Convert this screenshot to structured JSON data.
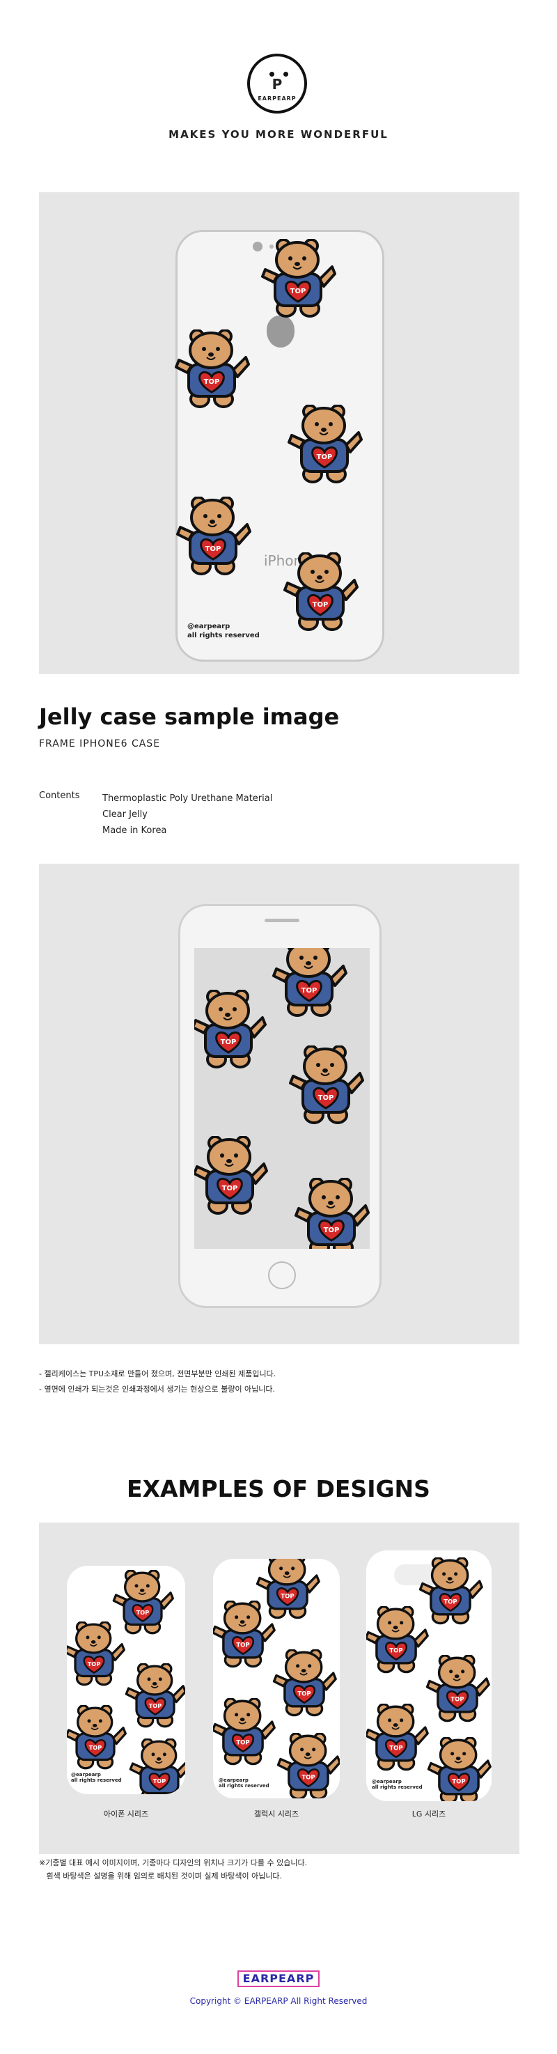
{
  "brand": {
    "logo_letter": "P",
    "logo_word": "EARPEARP",
    "tagline": "MAKES YOU MORE WONDERFUL"
  },
  "case_print": {
    "credit_line1": "@earpearp",
    "credit_line2": "all rights reserved",
    "bear_shirt_text": "TOP",
    "phone_text": "iPhone"
  },
  "product": {
    "title": "Jelly case sample image",
    "subtitle": "FRAME IPHONE6 CASE",
    "contents_label": "Contents",
    "contents": [
      "Thermoplastic Poly Urethane Material",
      "Clear Jelly",
      "Made in Korea"
    ]
  },
  "notes": [
    "- 젤리케이스는 TPU소재로 만들어 졌으며, 전면부분만 인쇄된 제품입니다.",
    "- 옆면에 인쇄가 되는것은 인쇄과정에서 생기는 현상으로 불량이 아닙니다."
  ],
  "examples": {
    "title": "EXAMPLES OF DESIGNS",
    "items": [
      {
        "label": "아이폰 시리즈"
      },
      {
        "label": "갤럭시 시리즈"
      },
      {
        "label": "LG 시리즈"
      }
    ]
  },
  "footnote": [
    "※기종별 대표 예시 이미지이며, 기종마다 디자인의 위치나 크기가 다를 수 있습니다.",
    "   흰색 바탕색은 설명을 위해 임의로 배치된 것이며 실제 바탕색이 아닙니다."
  ],
  "footer": {
    "brand_box": "EARPEARP",
    "copyright": "Copyright © EARPEARP All Right Reserved"
  },
  "colors": {
    "bear_fur": "#d9a06a",
    "bear_shirt": "#3e5e9e",
    "heart": "#d62a2a",
    "panel": "#e6e6e6",
    "brand_blue": "#2a2aa8",
    "brand_pink": "#e040a0"
  }
}
